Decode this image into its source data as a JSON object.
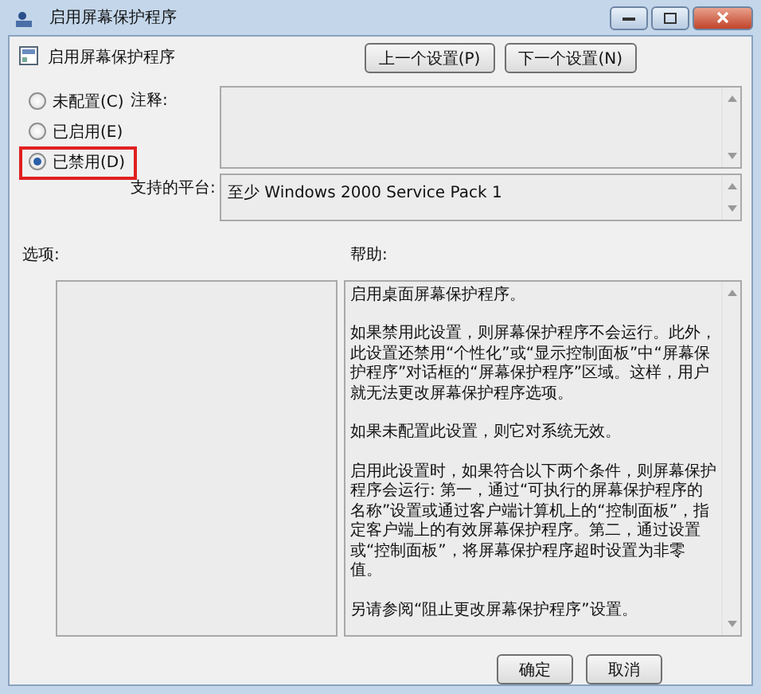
{
  "window": {
    "title": "启用屏幕保护程序"
  },
  "header": {
    "title": "启用屏幕保护程序"
  },
  "nav_buttons": [
    {
      "label": "上一个设置(P)"
    },
    {
      "label": "下一个设置(N)"
    }
  ],
  "state_options": [
    {
      "label": "未配置(C)",
      "selected": false,
      "highlighted": false
    },
    {
      "label": "已启用(E)",
      "selected": false,
      "highlighted": false
    },
    {
      "label": "已禁用(D)",
      "selected": true,
      "highlighted": true
    }
  ],
  "comment": {
    "label": "注释:"
  },
  "platform": {
    "label": "支持的平台:",
    "value": "至少 Windows 2000 Service Pack 1"
  },
  "options": {
    "label": "选项:"
  },
  "help": {
    "label": "帮助:",
    "paragraphs": [
      "启用桌面屏幕保护程序。",
      "如果禁用此设置，则屏幕保护程序不会运行。此外，此设置还禁用“个性化”或“显示控制面板”中“屏幕保护程序”对话框的“屏幕保护程序”区域。这样，用户就无法更改屏幕保护程序选项。",
      "如果未配置此设置，则它对系统无效。",
      "启用此设置时，如果符合以下两个条件，则屏幕保护程序会运行: 第一，通过“可执行的屏幕保护程序的名称”设置或通过客户端计算机上的“控制面板”，指定客户端上的有效屏幕保护程序。第二，通过设置或“控制面板”，将屏幕保护程序超时设置为非零值。",
      "另请参阅“阻止更改屏幕保护程序”设置。"
    ]
  },
  "buttons": [
    {
      "label": "确定"
    },
    {
      "label": "取消"
    }
  ]
}
